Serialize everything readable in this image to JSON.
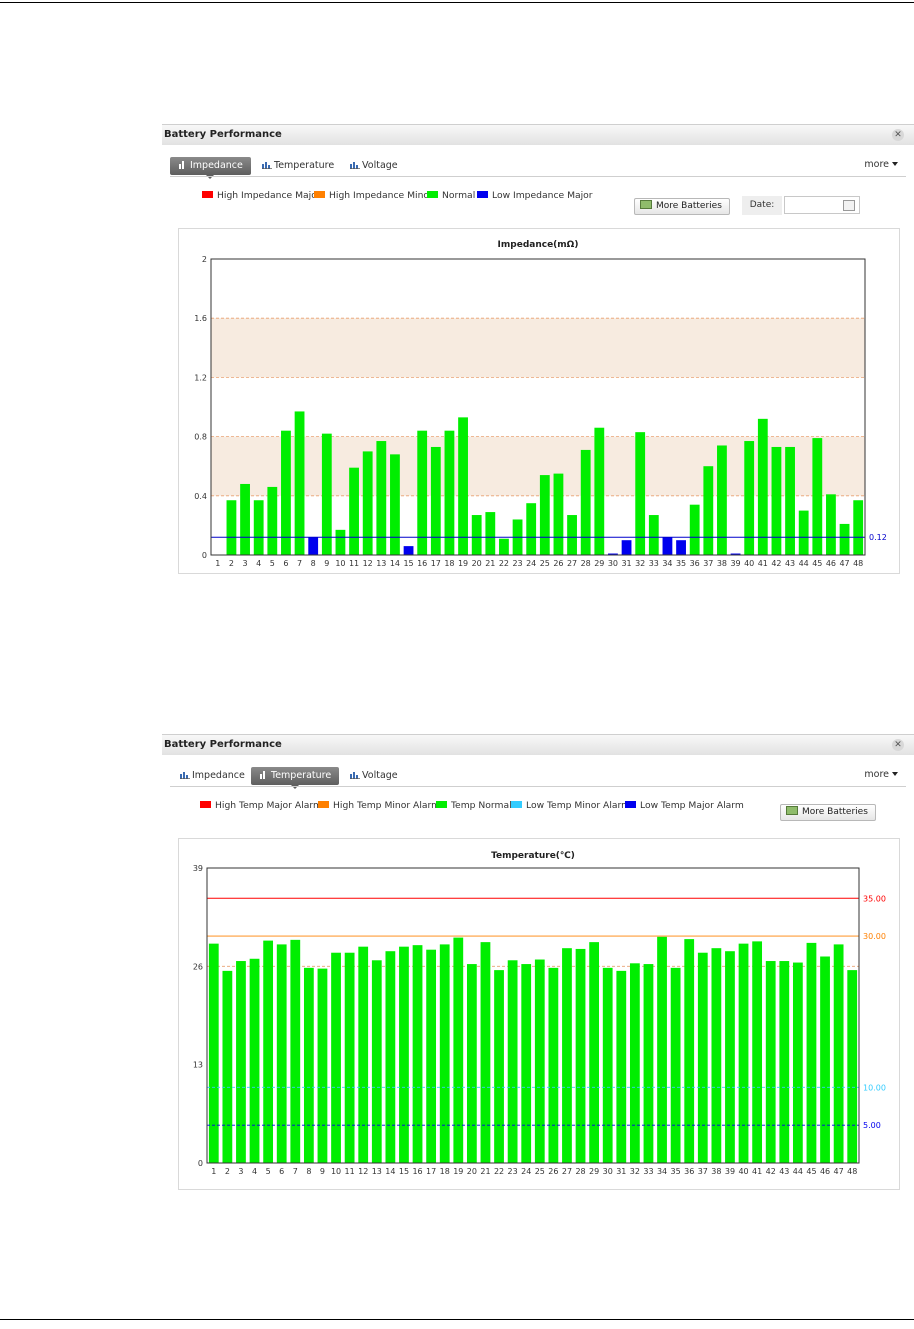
{
  "page": {
    "rule_color": "#000000"
  },
  "impedance_panel": {
    "title": "Battery Performance",
    "close_icon": "close-icon",
    "tabs": [
      {
        "label": "Impedance",
        "active": true
      },
      {
        "label": "Temperature",
        "active": false
      },
      {
        "label": "Voltage",
        "active": false
      }
    ],
    "more_label": "more",
    "legend": [
      {
        "label": "High Impedance Major",
        "color": "#ff0000"
      },
      {
        "label": "High Impedance Minor",
        "color": "#ff8000"
      },
      {
        "label": "Normal",
        "color": "#00ee00"
      },
      {
        "label": "Low Impedance Major",
        "color": "#0000ee"
      }
    ],
    "more_batteries_label": "More Batteries",
    "date_label": "Date:",
    "date_value": ""
  },
  "temperature_panel": {
    "title": "Battery Performance",
    "close_icon": "close-icon",
    "tabs": [
      {
        "label": "Impedance",
        "active": false
      },
      {
        "label": "Temperature",
        "active": true
      },
      {
        "label": "Voltage",
        "active": false
      }
    ],
    "more_label": "more",
    "legend": [
      {
        "label": "High Temp Major Alarm",
        "color": "#ff0000"
      },
      {
        "label": "High Temp Minor Alarm",
        "color": "#ff8000"
      },
      {
        "label": "Temp Normal",
        "color": "#00ee00"
      },
      {
        "label": "Low Temp Minor Alarm",
        "color": "#33ccff"
      },
      {
        "label": "Low Temp Major Alarm",
        "color": "#0000ee"
      }
    ],
    "more_batteries_label": "More Batteries"
  },
  "chart_data": [
    {
      "type": "bar",
      "title": "Impedance(mΩ)",
      "categories": [
        "1",
        "2",
        "3",
        "4",
        "5",
        "6",
        "7",
        "8",
        "9",
        "10",
        "11",
        "12",
        "13",
        "14",
        "15",
        "16",
        "17",
        "18",
        "19",
        "20",
        "21",
        "22",
        "23",
        "24",
        "25",
        "26",
        "27",
        "28",
        "29",
        "30",
        "31",
        "32",
        "33",
        "34",
        "35",
        "36",
        "37",
        "38",
        "39",
        "40",
        "41",
        "42",
        "43",
        "44",
        "45",
        "46",
        "47",
        "48"
      ],
      "values": [
        0,
        0.37,
        0.48,
        0.37,
        0.46,
        0.84,
        0.97,
        0.12,
        0.82,
        0.17,
        0.59,
        0.7,
        0.77,
        0.68,
        0.06,
        0.84,
        0.73,
        0.84,
        0.93,
        0.27,
        0.29,
        0.11,
        0.24,
        0.35,
        0.54,
        0.55,
        0.27,
        0.71,
        0.86,
        0.01,
        0.1,
        0.83,
        0.27,
        0.12,
        0.1,
        0.34,
        0.6,
        0.74,
        0.01,
        0.77,
        0.92,
        0.73,
        0.73,
        0.3,
        0.79,
        0.41,
        0.21,
        0.37
      ],
      "colors": [
        "#00ee00",
        "#00ee00",
        "#00ee00",
        "#00ee00",
        "#00ee00",
        "#00ee00",
        "#00ee00",
        "#0000ee",
        "#00ee00",
        "#00ee00",
        "#00ee00",
        "#00ee00",
        "#00ee00",
        "#00ee00",
        "#0000ee",
        "#00ee00",
        "#00ee00",
        "#00ee00",
        "#00ee00",
        "#00ee00",
        "#00ee00",
        "#00ee00",
        "#00ee00",
        "#00ee00",
        "#00ee00",
        "#00ee00",
        "#00ee00",
        "#00ee00",
        "#00ee00",
        "#0000ee",
        "#0000ee",
        "#00ee00",
        "#00ee00",
        "#0000ee",
        "#0000ee",
        "#00ee00",
        "#00ee00",
        "#00ee00",
        "#0000ee",
        "#00ee00",
        "#00ee00",
        "#00ee00",
        "#00ee00",
        "#00ee00",
        "#00ee00",
        "#00ee00",
        "#00ee00",
        "#00ee00"
      ],
      "ylim": [
        0,
        2
      ],
      "yticks": [
        "0",
        "0.4",
        "0.8",
        "1.2",
        "1.6",
        "2"
      ],
      "yticks_values": [
        0,
        0.4,
        0.8,
        1.2,
        1.6,
        2
      ],
      "gridlines_dashed": [
        0.4,
        0.8,
        1.2,
        1.6
      ],
      "shaded_bands": [
        {
          "from": 1.2,
          "to": 1.6,
          "color": "#f7ebe0"
        },
        {
          "from": 0.4,
          "to": 0.8,
          "color": "#f7ebe0"
        }
      ],
      "threshold_lines": [
        {
          "value": 0.12,
          "label": "0.12",
          "color": "#0000cc"
        }
      ],
      "grid": true
    },
    {
      "type": "bar",
      "title": "Temperature(℃)",
      "categories": [
        "1",
        "2",
        "3",
        "4",
        "5",
        "6",
        "7",
        "8",
        "9",
        "10",
        "11",
        "12",
        "13",
        "14",
        "15",
        "16",
        "17",
        "18",
        "19",
        "20",
        "21",
        "22",
        "23",
        "24",
        "25",
        "26",
        "27",
        "28",
        "29",
        "30",
        "31",
        "32",
        "33",
        "34",
        "35",
        "36",
        "37",
        "38",
        "39",
        "40",
        "41",
        "42",
        "43",
        "44",
        "45",
        "46",
        "47",
        "48"
      ],
      "values": [
        29.0,
        25.4,
        26.7,
        27.0,
        29.4,
        28.9,
        29.5,
        25.8,
        25.7,
        27.8,
        27.8,
        28.6,
        26.8,
        28.0,
        28.6,
        28.8,
        28.2,
        28.9,
        29.8,
        26.3,
        29.2,
        25.5,
        26.8,
        26.3,
        26.9,
        25.8,
        28.4,
        28.3,
        29.2,
        25.8,
        25.4,
        26.4,
        26.3,
        29.9,
        25.8,
        29.6,
        27.8,
        28.4,
        28.0,
        29.0,
        29.3,
        26.7,
        26.7,
        26.5,
        29.1,
        27.3,
        28.9,
        25.5
      ],
      "colors": [
        "#00ee00"
      ],
      "ylim": [
        0,
        39
      ],
      "yticks": [
        "0",
        "13",
        "26",
        "39"
      ],
      "yticks_values": [
        0,
        13,
        26,
        39
      ],
      "gridlines_dashed": [
        26
      ],
      "threshold_lines": [
        {
          "value": 35,
          "label": "35.00",
          "color": "#ff0000",
          "style": "solid"
        },
        {
          "value": 30,
          "label": "30.00",
          "color": "#ff8000",
          "style": "solid"
        },
        {
          "value": 10,
          "label": "10.00",
          "color": "#33ccff",
          "style": "dashed"
        },
        {
          "value": 5,
          "label": "5.00",
          "color": "#0000ee",
          "style": "dashed"
        }
      ],
      "grid": true
    }
  ]
}
